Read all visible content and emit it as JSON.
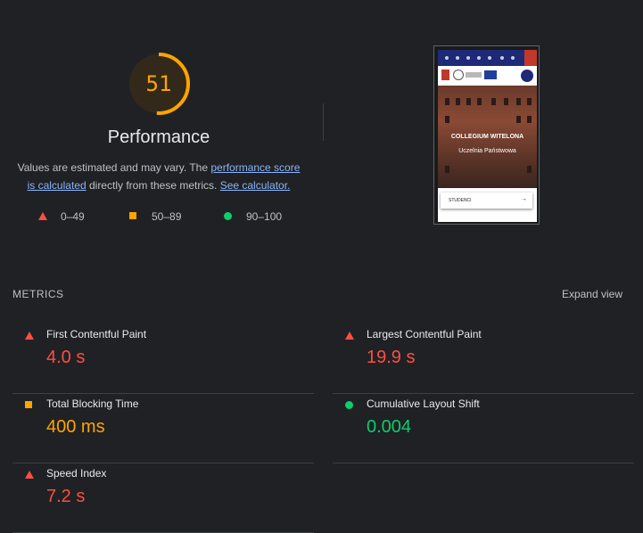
{
  "score": {
    "value": "51",
    "fraction": 0.51,
    "title": "Performance",
    "color": "#ffa400"
  },
  "description": {
    "text_before": "Values are estimated and may vary. The ",
    "link1": "performance score is calculated",
    "text_middle": " directly from these metrics. ",
    "link2": "See calculator."
  },
  "legend": [
    {
      "label": "0–49",
      "icon": "triangle-icon",
      "color": "#ff4e42"
    },
    {
      "label": "50–89",
      "icon": "square-icon",
      "color": "#ffa400"
    },
    {
      "label": "90–100",
      "icon": "circle-icon",
      "color": "#0cce6b"
    }
  ],
  "screenshot": {
    "hero_line1": "COLLEGIUM WITELONA",
    "hero_line2": "Uczelnia Państwowa",
    "card_label": "STUDENCI",
    "card_arrow": "→"
  },
  "metrics": {
    "heading": "METRICS",
    "expand_label": "Expand view",
    "items": [
      {
        "title": "First Contentful Paint",
        "value": "4.0 s",
        "status": "fail",
        "icon": "triangle-icon"
      },
      {
        "title": "Largest Contentful Paint",
        "value": "19.9 s",
        "status": "fail",
        "icon": "triangle-icon"
      },
      {
        "title": "Total Blocking Time",
        "value": "400 ms",
        "status": "average",
        "icon": "square-icon"
      },
      {
        "title": "Cumulative Layout Shift",
        "value": "0.004",
        "status": "pass",
        "icon": "circle-icon"
      },
      {
        "title": "Speed Index",
        "value": "7.2 s",
        "status": "fail",
        "icon": "triangle-icon"
      }
    ]
  }
}
